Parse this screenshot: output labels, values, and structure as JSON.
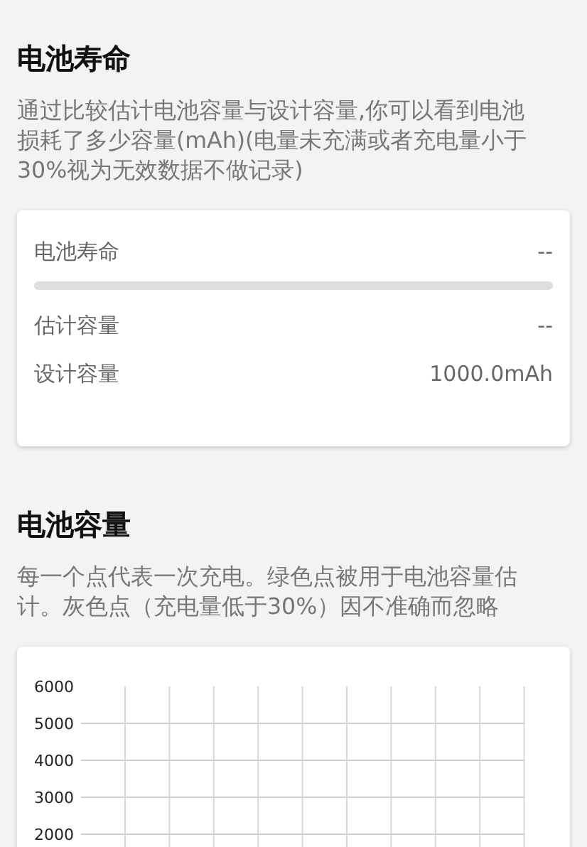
{
  "sections": [
    {
      "title": "电池寿命",
      "description": "通过比较估计电池容量与设计容量,你可以看到电池损耗了多少容量(mAh)(电量未充满或者充电量小于30%视为无效数据不做记录)",
      "card": {
        "kind": "info",
        "rows": [
          {
            "kind": "progress",
            "label": "电池寿命",
            "value": "--",
            "level": 0
          },
          {
            "kind": "plain",
            "label": "估计容量",
            "value": "--"
          },
          {
            "kind": "plain",
            "label": "设计容量",
            "value": "1000.0mAh"
          }
        ]
      }
    },
    {
      "title": "电池容量",
      "description": "每一个点代表一次充电。绿色点被用于电池容量估计。灰色点（充电量低于30%）因不准确而忽略",
      "card": {
        "kind": "chart",
        "y_axis_labels": [
          "6000",
          "5000",
          "4000",
          "3000",
          "2000"
        ]
      }
    }
  ]
}
